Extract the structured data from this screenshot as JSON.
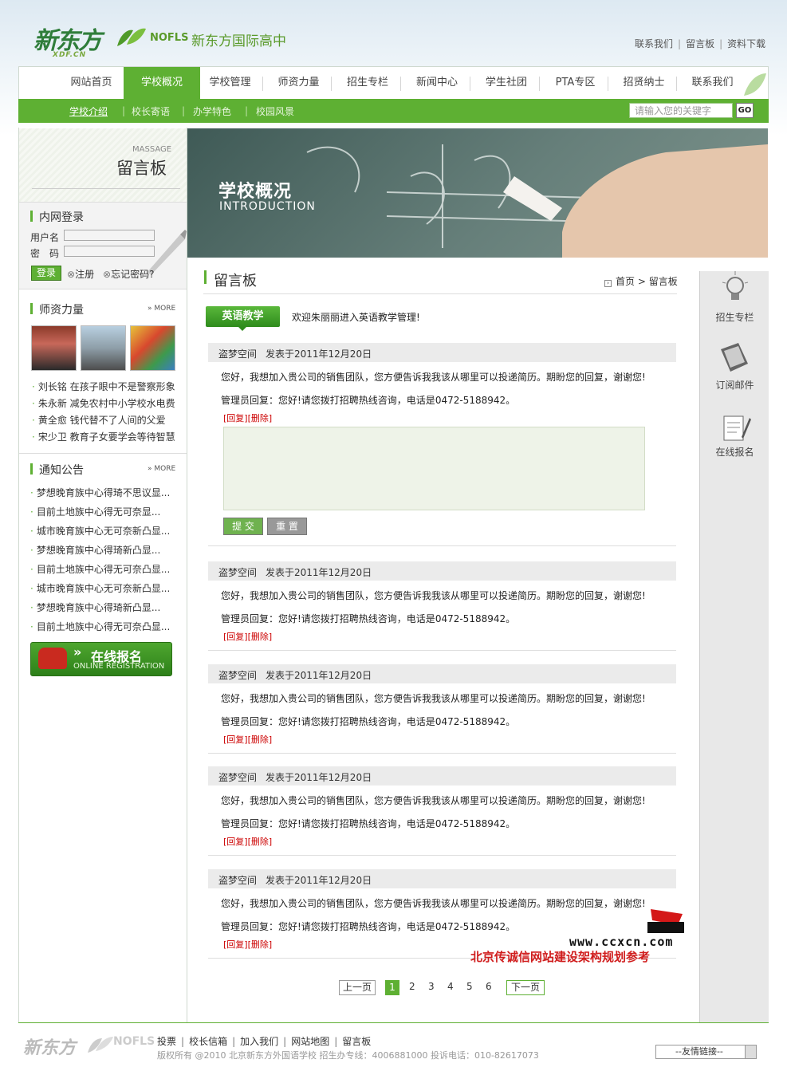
{
  "header": {
    "logo_cn": "新东方",
    "logo_sub": "XDF.CN",
    "nofls": "NOFLS",
    "school": "新东方国际高中",
    "toplinks": [
      "联系我们",
      "留言板",
      "资料下载"
    ]
  },
  "nav": {
    "items": [
      "网站首页",
      "学校概况",
      "学校管理",
      "师资力量",
      "招生专栏",
      "新闻中心",
      "学生社团",
      "PTA专区",
      "招贤纳士",
      "联系我们"
    ],
    "active": 1
  },
  "subnav": {
    "items": [
      "学校介绍",
      "校长寄语",
      "办学特色",
      "校园风景"
    ],
    "search_placeholder": "请输入您的关键字",
    "go": "GO"
  },
  "sidebar": {
    "massage": "MASSAGE",
    "title": "留言板",
    "login": {
      "title": "内网登录",
      "user_label": "用户名",
      "pwd_label": "密　码",
      "login": "登录",
      "register": "注册",
      "forgot": "忘记密码?"
    },
    "teachers": {
      "title": "师资力量",
      "more": "MORE",
      "items": [
        {
          "name": "刘长铭",
          "title": "在孩子眼中不是警察形象"
        },
        {
          "name": "朱永新",
          "title": "减免农村中小学校水电费"
        },
        {
          "name": "黄全愈",
          "title": "钱代替不了人间的父爱"
        },
        {
          "name": "宋少卫",
          "title": "教育子女要学会等待智慧"
        }
      ]
    },
    "notices": {
      "title": "通知公告",
      "more": "MORE",
      "items": [
        "梦想晚育族中心得琦不思议显...",
        "目前土地族中心得无可奈显...",
        "城市晚育族中心无可奈新凸显...",
        "梦想晚育族中心得琦新凸显...",
        "目前土地族中心得无可奈凸显...",
        "城市晚育族中心无可奈新凸显...",
        "梦想晚育族中心得琦新凸显...",
        "目前土地族中心得无可奈凸显..."
      ]
    },
    "register_banner": {
      "cn": "在线报名",
      "en": "ONLINE REGISTRATION"
    }
  },
  "banner": {
    "cn": "学校概况",
    "en": "INTRODUCTION"
  },
  "main": {
    "title": "留言板",
    "crumb_home": "首页",
    "crumb_current": "留言板",
    "tag": "英语教学",
    "welcome": "欢迎朱丽丽进入英语教学管理!",
    "messages": [
      {
        "author": "盗梦空间",
        "date": "发表于2011年12月20日",
        "content": "您好，我想加入贵公司的销售团队，您方便告诉我我该从哪里可以投递简历。期盼您的回复，谢谢您!",
        "reply": "管理员回复：您好!请您拨打招聘热线咨询，电话是0472-5188942。",
        "actions": "[回复][删除]"
      },
      {
        "author": "盗梦空间",
        "date": "发表于2011年12月20日",
        "content": "您好，我想加入贵公司的销售团队，您方便告诉我我该从哪里可以投递简历。期盼您的回复，谢谢您!",
        "reply": "管理员回复：您好!请您拨打招聘热线咨询，电话是0472-5188942。",
        "actions": "[回复][删除]"
      },
      {
        "author": "盗梦空间",
        "date": "发表于2011年12月20日",
        "content": "您好，我想加入贵公司的销售团队，您方便告诉我我该从哪里可以投递简历。期盼您的回复，谢谢您!",
        "reply": "管理员回复：您好!请您拨打招聘热线咨询，电话是0472-5188942。",
        "actions": "[回复][删除]"
      },
      {
        "author": "盗梦空间",
        "date": "发表于2011年12月20日",
        "content": "您好，我想加入贵公司的销售团队，您方便告诉我我该从哪里可以投递简历。期盼您的回复，谢谢您!",
        "reply": "管理员回复：您好!请您拨打招聘热线咨询，电话是0472-5188942。",
        "actions": "[回复][删除]"
      },
      {
        "author": "盗梦空间",
        "date": "发表于2011年12月20日",
        "content": "您好，我想加入贵公司的销售团队，您方便告诉我我该从哪里可以投递简历。期盼您的回复，谢谢您!",
        "reply": "管理员回复：您好!请您拨打招聘热线咨询，电话是0472-5188942。",
        "actions": "[回复][删除]"
      }
    ],
    "submit": "提 交",
    "reset": "重 置",
    "pager": {
      "prev": "上一页",
      "pages": [
        "1",
        "2",
        "3",
        "4",
        "5",
        "6"
      ],
      "current": "1",
      "next": "下一页"
    }
  },
  "rightbar": [
    "招生专栏",
    "订阅邮件",
    "在线报名"
  ],
  "watermark": {
    "url": "www.ccxcn.com",
    "cn": "北京传诚信网站建设架构规划参考"
  },
  "footer": {
    "logo": "新东方",
    "nofls": "NOFLS",
    "links": [
      "投票",
      "校长信箱",
      "加入我们",
      "网站地图",
      "留言板"
    ],
    "copyright": "版权所有 @2010 北京新东方外国语学校  招生办专线：4006881000  投诉电话：010-82617073",
    "friend_links": "--友情链接--"
  }
}
